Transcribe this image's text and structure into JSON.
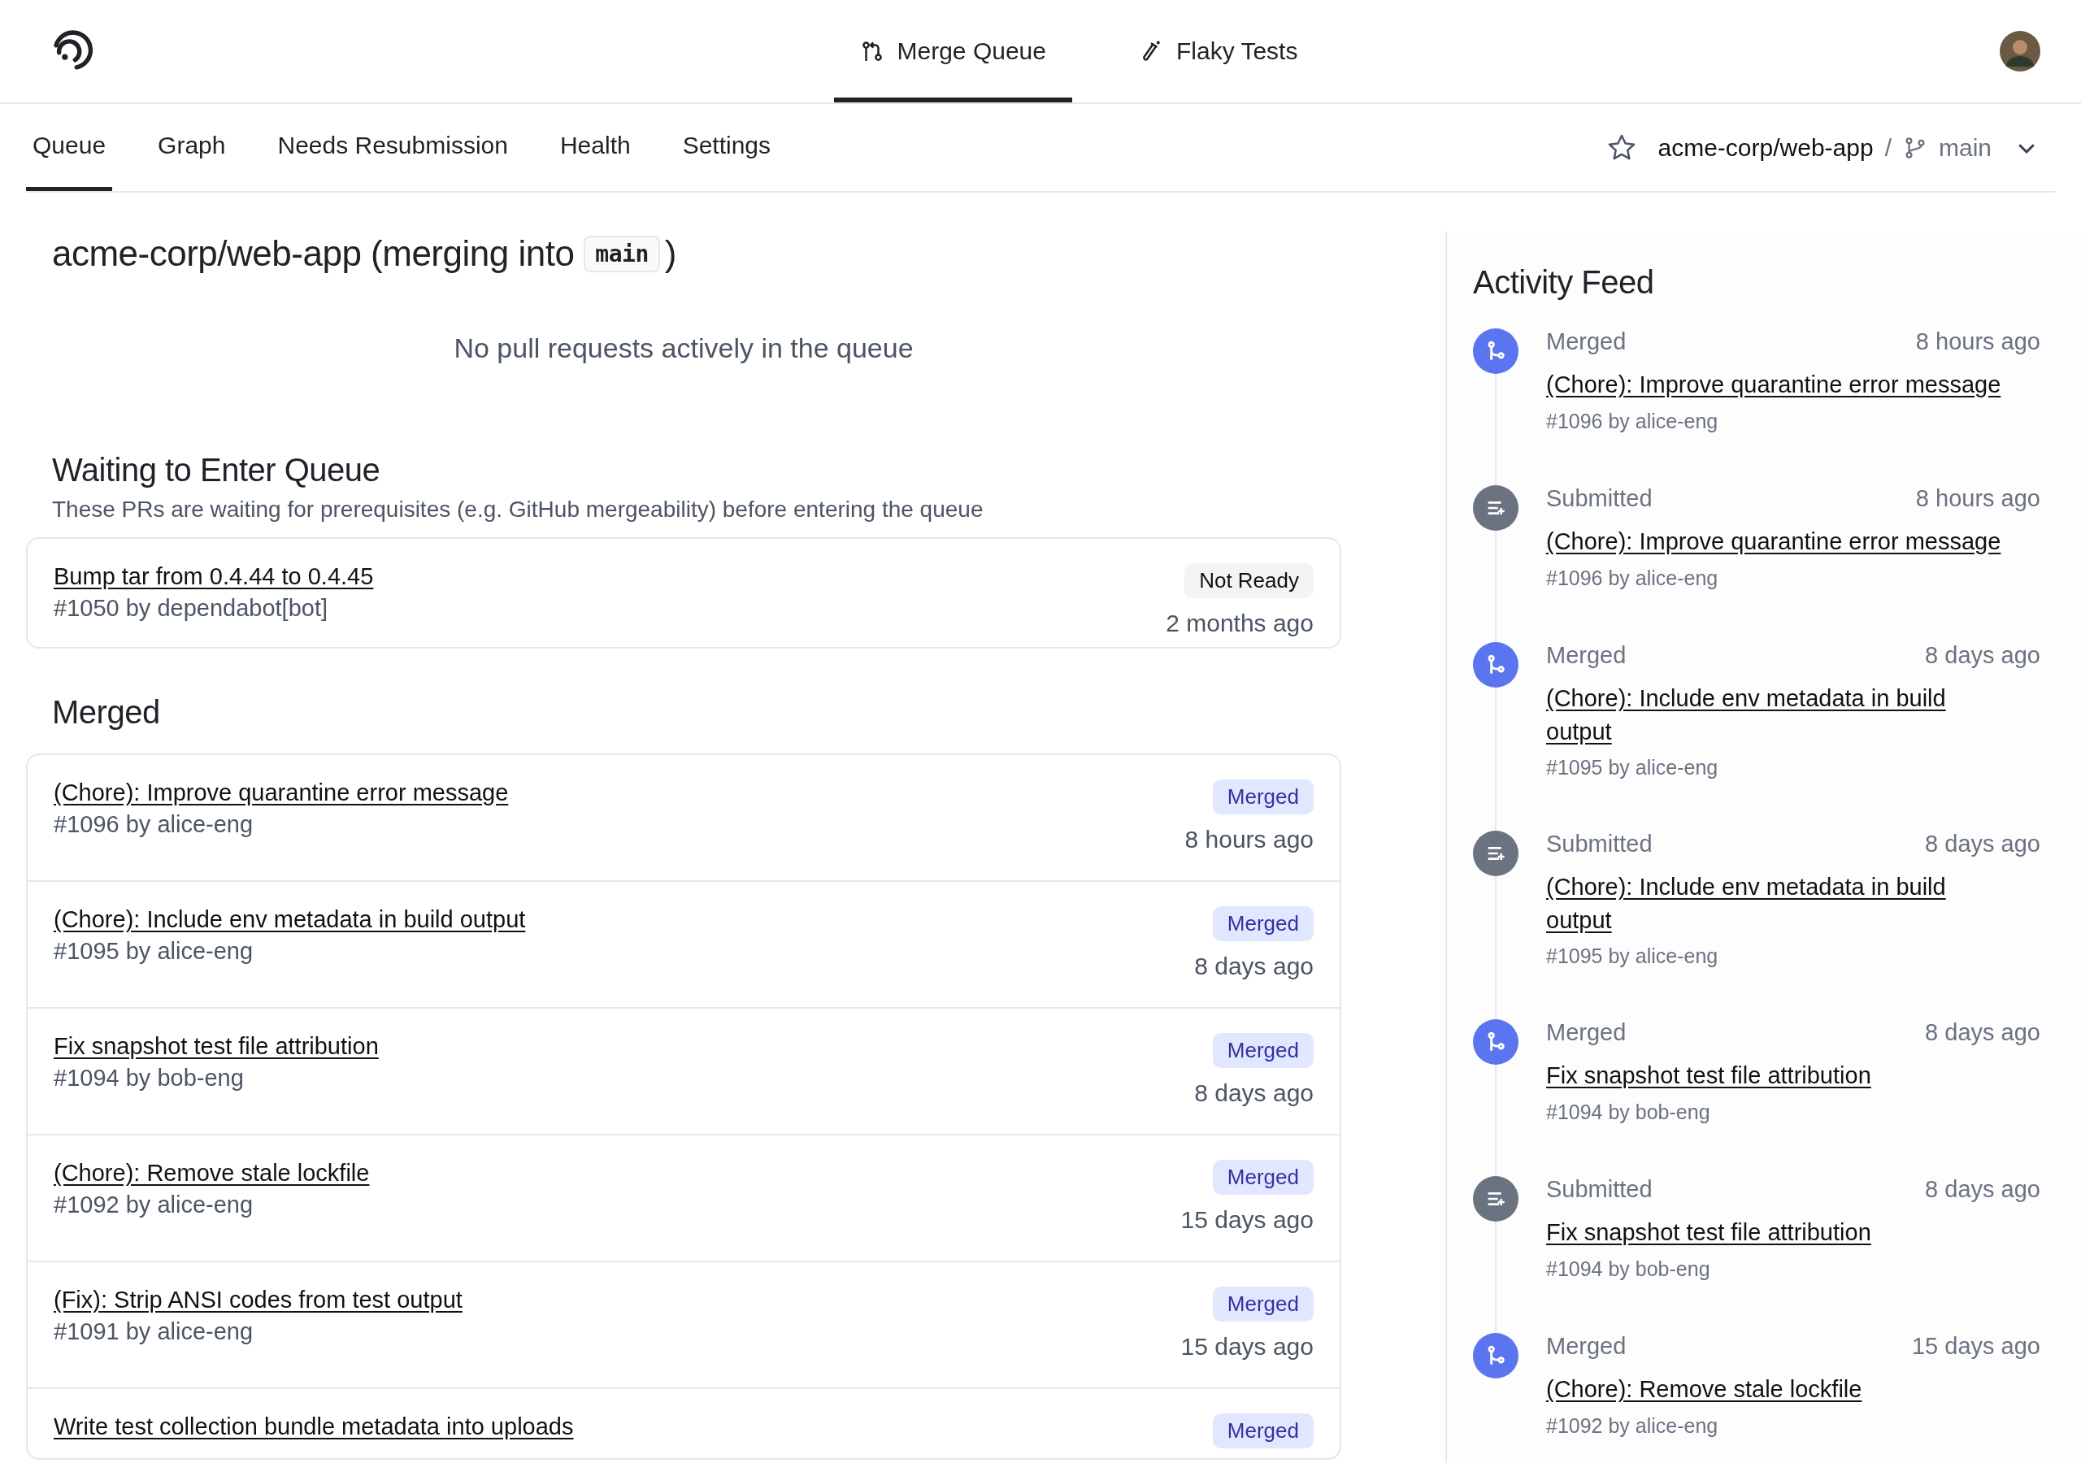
{
  "top_nav": {
    "tabs": [
      {
        "label": "Merge Queue",
        "kind": "merge",
        "selected": true
      },
      {
        "label": "Flaky Tests",
        "kind": "test",
        "selected": false
      }
    ]
  },
  "sub_nav": {
    "tabs": [
      {
        "label": "Queue",
        "selected": true
      },
      {
        "label": "Graph",
        "selected": false
      },
      {
        "label": "Needs Resubmission",
        "selected": false
      },
      {
        "label": "Health",
        "selected": false
      },
      {
        "label": "Settings",
        "selected": false
      }
    ],
    "repo": "acme-corp/web-app",
    "separator": "/",
    "branch": "main"
  },
  "main": {
    "title": "acme-corp/web-app (merging into",
    "branch": "main",
    "title_end": ")",
    "empty_message": "No pull requests actively in the queue",
    "waiting": {
      "title": "Waiting to Enter Queue",
      "subtitle": "These PRs are waiting for prerequisites (e.g. GitHub mergeability) before entering the queue",
      "items": [
        {
          "title": "Bump tar from 0.4.44 to 0.4.45",
          "meta": "#1050 by dependabot[bot]",
          "status": "Not Ready",
          "kind": "not_ready",
          "time": "2 months ago"
        }
      ]
    },
    "merged": {
      "title": "Merged",
      "items": [
        {
          "title": "(Chore): Improve quarantine error message",
          "meta": "#1096 by alice-eng",
          "status": "Merged",
          "kind": "merged",
          "time": "8 hours ago"
        },
        {
          "title": "(Chore): Include env metadata in build output",
          "meta": "#1095 by alice-eng",
          "status": "Merged",
          "kind": "merged",
          "time": "8 days ago"
        },
        {
          "title": "Fix snapshot test file attribution",
          "meta": "#1094 by bob-eng",
          "status": "Merged",
          "kind": "merged",
          "time": "8 days ago"
        },
        {
          "title": "(Chore): Remove stale lockfile",
          "meta": "#1092 by alice-eng",
          "status": "Merged",
          "kind": "merged",
          "time": "15 days ago"
        },
        {
          "title": "(Fix): Strip ANSI codes from test output",
          "meta": "#1091 by alice-eng",
          "status": "Merged",
          "kind": "merged",
          "time": "15 days ago"
        },
        {
          "title": "Write test collection bundle metadata into uploads",
          "status": "Merged",
          "kind": "merged"
        }
      ]
    }
  },
  "activity": {
    "title": "Activity Feed",
    "items": [
      {
        "kind": "merged",
        "label": "Merged",
        "time": "8 hours ago",
        "title": "(Chore): Improve quarantine error message",
        "meta": "#1096 by alice-eng"
      },
      {
        "kind": "submitted",
        "label": "Submitted",
        "time": "8 hours ago",
        "title": "(Chore): Improve quarantine error message",
        "meta": "#1096 by alice-eng"
      },
      {
        "kind": "merged",
        "label": "Merged",
        "time": "8 days ago",
        "title": "(Chore): Include env metadata in build output",
        "meta": "#1095 by alice-eng"
      },
      {
        "kind": "submitted",
        "label": "Submitted",
        "time": "8 days ago",
        "title": "(Chore): Include env metadata in build output",
        "meta": "#1095 by alice-eng"
      },
      {
        "kind": "merged",
        "label": "Merged",
        "time": "8 days ago",
        "title": "Fix snapshot test file attribution",
        "meta": "#1094 by bob-eng"
      },
      {
        "kind": "submitted",
        "label": "Submitted",
        "time": "8 days ago",
        "title": "Fix snapshot test file attribution",
        "meta": "#1094 by bob-eng"
      },
      {
        "kind": "merged",
        "label": "Merged",
        "time": "15 days ago",
        "title": "(Chore): Remove stale lockfile",
        "meta": "#1092 by alice-eng"
      }
    ]
  }
}
